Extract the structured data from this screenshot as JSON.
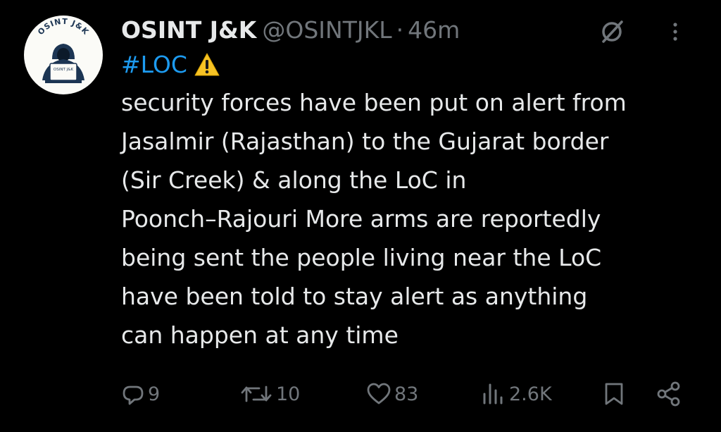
{
  "tweet": {
    "author_name": "OSINT J&K",
    "handle": "@OSINTJKL",
    "separator": "·",
    "time": "46m",
    "hashtag": "#LOC",
    "body": "security forces have been put on alert from\nJasalmir (Rajasthan) to the Gujarat border\n(Sir Creek) & along the LoC in\nPoonch–Rajouri More arms are reportedly\nbeing sent the people living near the LoC\nhave been told to stay alert as anything\ncan happen at any time",
    "avatar": {
      "arc_text": "OSINT J&K",
      "laptop_text": "OSINT J&K"
    }
  },
  "actions": {
    "reply_count": "9",
    "repost_count": "10",
    "like_count": "83",
    "view_count": "2.6K"
  },
  "icons": {
    "grok": "grok-icon",
    "more": "more-icon",
    "warning": "warning-icon",
    "reply": "reply-icon",
    "repost": "repost-icon",
    "like": "heart-icon",
    "views": "views-icon",
    "bookmark": "bookmark-icon",
    "share": "share-icon"
  },
  "colors": {
    "background": "#000000",
    "text": "#e7e9ea",
    "secondary": "#71767b",
    "link": "#1d9bf0",
    "avatar_navy": "#1c3553"
  }
}
